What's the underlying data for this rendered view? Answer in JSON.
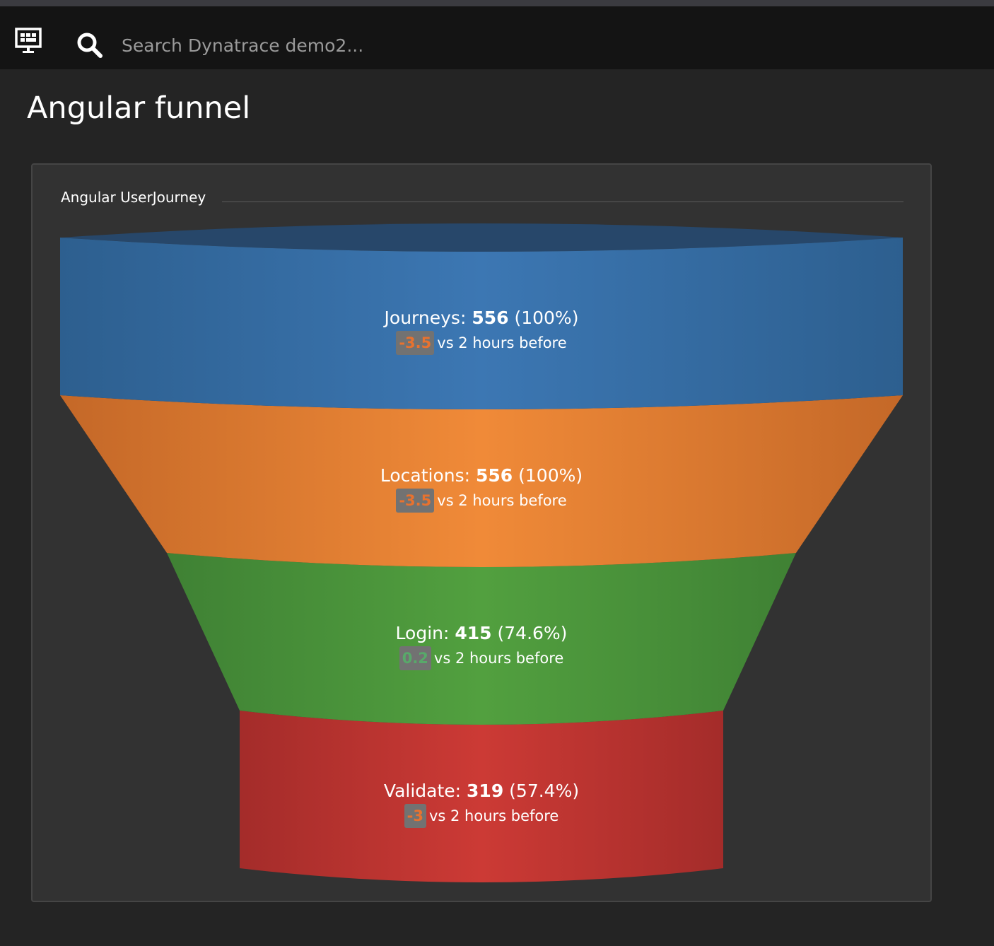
{
  "header": {
    "dashboard_icon": "dashboard-icon",
    "search_icon": "search-icon",
    "search_placeholder": "Search Dynatrace demo2..."
  },
  "page": {
    "title": "Angular funnel"
  },
  "tile": {
    "title": "Angular UserJourney"
  },
  "colors": {
    "Journeys": "#3a73ad",
    "Locations": "#ed8535",
    "Login": "#4e9a3c",
    "Validate": "#c93833",
    "delta_negative": "#e8722f",
    "delta_positive": "#58a96a"
  },
  "chart_data": {
    "type": "funnel",
    "stages": [
      {
        "name": "Journeys",
        "value": 556,
        "percent": "100%",
        "delta": "-3.5",
        "delta_direction": "negative",
        "comparison": "vs 2 hours before"
      },
      {
        "name": "Locations",
        "value": 556,
        "percent": "100%",
        "delta": "-3.5",
        "delta_direction": "negative",
        "comparison": "vs 2 hours before"
      },
      {
        "name": "Login",
        "value": 415,
        "percent": "74.6%",
        "delta": "0.2",
        "delta_direction": "positive",
        "comparison": "vs 2 hours before"
      },
      {
        "name": "Validate",
        "value": 319,
        "percent": "57.4%",
        "delta": "-3",
        "delta_direction": "negative",
        "comparison": "vs 2 hours before"
      }
    ]
  }
}
